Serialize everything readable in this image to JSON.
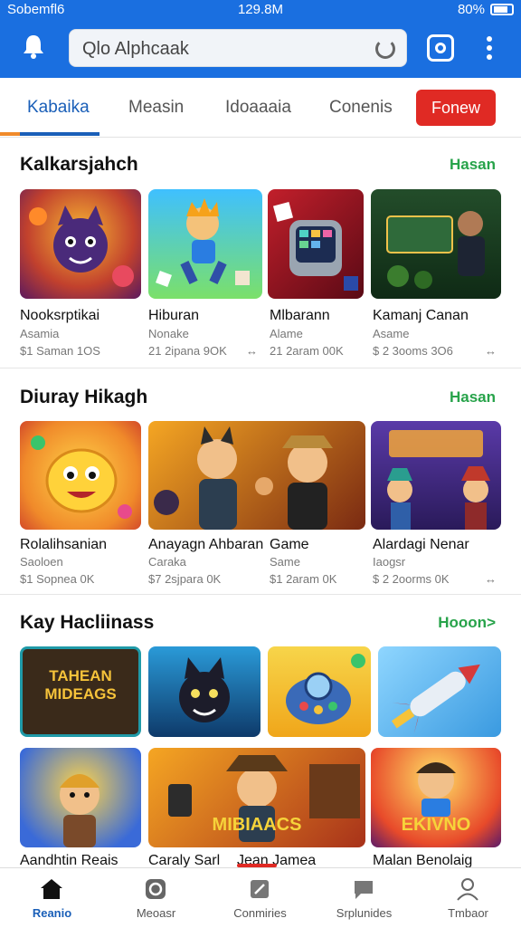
{
  "status_bar": {
    "carrier": "Sobemfl6",
    "time": "129.8M",
    "battery": "80%"
  },
  "search": {
    "placeholder": "Qlo Alphcaak"
  },
  "tabs": [
    {
      "label": "Kabaika",
      "active": true
    },
    {
      "label": "Measin",
      "active": false
    },
    {
      "label": "Idoaaaia",
      "active": false
    },
    {
      "label": "Conenis",
      "active": false
    }
  ],
  "renew_button": "Fonew",
  "sections": [
    {
      "title": "Kalkarsjahch",
      "link": "Hasan",
      "items": [
        {
          "title": "Nooksrptikai",
          "sub": "Asamia",
          "meta": "$1 Saman 1OS"
        },
        {
          "title": "Hiburan",
          "sub": "Nonake",
          "meta": "21 2ipana 9OK"
        },
        {
          "title": "Mlbarann",
          "sub": "Alame",
          "meta": "21 2aram 00K"
        },
        {
          "title": "Kamanj Canan",
          "sub": "Asame",
          "meta": "$ 2 3ooms 3O6"
        }
      ]
    },
    {
      "title": "Diuray Hikagh",
      "link": "Hasan",
      "items": [
        {
          "title": "Rolalihsanian",
          "sub": "Saoloen",
          "meta": "$1 Sopnea 0K"
        },
        {
          "title": "Anayagn Ahbaran",
          "sub": "Caraka",
          "meta": "$7 2sjpara 0K"
        },
        {
          "title": "Game",
          "sub": "Same",
          "meta": "$1 2aram 0K"
        },
        {
          "title": "Alardagi Nenar",
          "sub": "Iaogsr",
          "meta": "$ 2 2oorms 0K"
        }
      ]
    },
    {
      "title": "Kay Hacliinass",
      "link": "Hooon>",
      "items": [
        {
          "title": "Aandhtin Reais",
          "banner": "TAHEAN MIDEAGS"
        },
        {
          "title": "Caraly Sarl",
          "banner": ""
        },
        {
          "title": "Jean Jamea",
          "banner": "MIBIAACS"
        },
        {
          "title": "Malan Benolaig",
          "banner": "EKIVNO"
        }
      ]
    }
  ],
  "bottom_nav": [
    {
      "label": "Reanio",
      "icon": "home-icon",
      "active": true
    },
    {
      "label": "Meoasr",
      "icon": "camera-icon",
      "active": false
    },
    {
      "label": "Conmiries",
      "icon": "edit-icon",
      "active": false
    },
    {
      "label": "Srplunides",
      "icon": "chat-icon",
      "active": false
    },
    {
      "label": "Tmbaor",
      "icon": "user-icon",
      "active": false
    }
  ],
  "colors": {
    "brand": "#1a6fe0",
    "accent_green": "#27a34a",
    "renew_red": "#e02a24",
    "tab_active": "#1a5fb8"
  }
}
